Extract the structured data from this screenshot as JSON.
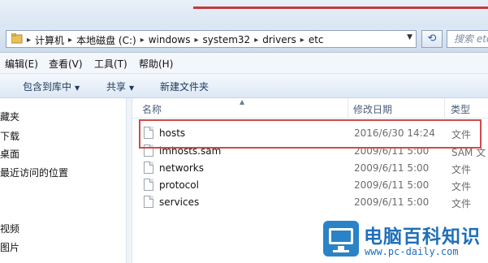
{
  "titlebar": {
    "accent_color": "#c23b3b"
  },
  "address": {
    "crumbs": [
      "计算机",
      "本地磁盘 (C:)",
      "windows",
      "system32",
      "drivers",
      "etc"
    ],
    "search_placeholder": "搜索 etc"
  },
  "menu": {
    "items": [
      "编辑(E)",
      "查看(V)",
      "工具(T)",
      "帮助(H)"
    ]
  },
  "commands": {
    "include_library": "包含到库中",
    "share": "共享",
    "new_folder": "新建文件夹"
  },
  "nav": {
    "items": [
      "藏夹",
      "下载",
      "桌面",
      "最近访问的位置",
      "视频",
      "图片"
    ]
  },
  "columns": {
    "name": "名称",
    "modified": "修改日期",
    "type": "类型"
  },
  "files": [
    {
      "name": "hosts",
      "date": "2016/6/30 14:24",
      "type": "文件",
      "highlighted": true
    },
    {
      "name": "lmhosts.sam",
      "date": "2009/6/11 5:00",
      "type": "SAM 文",
      "highlighted": false
    },
    {
      "name": "networks",
      "date": "2009/6/11 5:00",
      "type": "文件",
      "highlighted": false
    },
    {
      "name": "protocol",
      "date": "2009/6/11 5:00",
      "type": "文件",
      "highlighted": false
    },
    {
      "name": "services",
      "date": "2009/6/11 5:00",
      "type": "文件",
      "highlighted": false
    }
  ],
  "watermark": {
    "title": "电脑百科知识",
    "url": "www.pc-daily.com",
    "color": "#1f6fb8"
  }
}
